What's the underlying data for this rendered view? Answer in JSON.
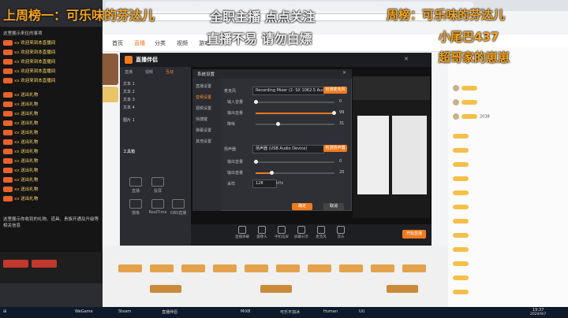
{
  "overlay": {
    "top_left": "上周榜一：可乐味的芬达儿",
    "top_mid": "全职主播  点点关注",
    "top_right": "周榜：可乐味的芬达儿",
    "right_2": "小尾巴437",
    "right_3": "超哥家的崽崽",
    "mid_2": "直播不易  请勿白嫖"
  },
  "site": {
    "nav": [
      "首页",
      "直播",
      "分类",
      "视频",
      "游戏"
    ],
    "right_badge": "2038"
  },
  "chat": {
    "header": "这里展示来往的事项",
    "rows": [
      {
        "name": "xx",
        "msg": "欢迎来到本直播间"
      },
      {
        "name": "xx",
        "msg": "欢迎来到本直播间"
      },
      {
        "name": "xx",
        "msg": "欢迎来到本直播间"
      },
      {
        "name": "xx",
        "msg": "欢迎来到本直播间"
      },
      {
        "name": "xx",
        "msg": "欢迎来到本直播间"
      },
      {
        "name": "xx",
        "msg": "送出礼物"
      },
      {
        "name": "xx",
        "msg": "送出礼物"
      },
      {
        "name": "xx",
        "msg": "送出礼物"
      },
      {
        "name": "xx",
        "msg": "送出礼物"
      },
      {
        "name": "xx",
        "msg": "送出礼物"
      },
      {
        "name": "xx",
        "msg": "送出礼物"
      },
      {
        "name": "xx",
        "msg": "送出礼物"
      },
      {
        "name": "xx",
        "msg": "送出礼物"
      },
      {
        "name": "xx",
        "msg": "送出礼物"
      },
      {
        "name": "xx",
        "msg": "送出礼物"
      },
      {
        "name": "xx",
        "msg": "送出礼物"
      },
      {
        "name": "xx",
        "msg": "送出礼物"
      }
    ],
    "notice": "这里展示你收到的礼物、道具、贵族开通及升级等相关信息"
  },
  "app": {
    "logo": "直播伴侣",
    "tabs": [
      "直播",
      "视频",
      "互动"
    ],
    "scenes": [
      "文本 1",
      "文本 2",
      "文本 3",
      "文本 4",
      "图片 1"
    ],
    "tools_label": "工具箱",
    "tools": [
      "直播",
      "投屏",
      "摄像",
      "RealTime",
      "OBS直播"
    ],
    "footer": [
      "直播弹幕",
      "摄像头",
      "手机投屏",
      "屏幕分享",
      "麦克风",
      "音乐",
      "媒体",
      "开始直播"
    ],
    "dialog_title": "系统设置",
    "sidebar": [
      "直播设置",
      "音频设置",
      "视频设置",
      "快捷键",
      "弹幕设置",
      "其他设置"
    ],
    "mic_label": "麦克风",
    "mic_device": "Recording Mixer (2- SX 1062.5 Audio...",
    "mic_btn": "检测麦克风",
    "vol_in": "输入音量",
    "vol_out": "输出音量",
    "noise": "降噪",
    "speaker_label": "扬声器",
    "speaker_device": "扬声器 (USB Audio Device)",
    "speaker_btn": "检测扬声器",
    "speaker_vol": "输出音量",
    "out_vol": "输出音量",
    "sample_label": "采样",
    "sample_val": "128",
    "sample_unit": "kHz",
    "values": [
      "0",
      "99",
      "31",
      "0",
      "20"
    ],
    "ok": "确定",
    "cancel": "取消"
  },
  "taskbar": {
    "items": [
      "WeGame",
      "Steam",
      "直播伴侣",
      "MiX8",
      "可乐不加冰",
      "Human",
      "UU"
    ],
    "time": "19:37",
    "date": "2020/9/7"
  }
}
